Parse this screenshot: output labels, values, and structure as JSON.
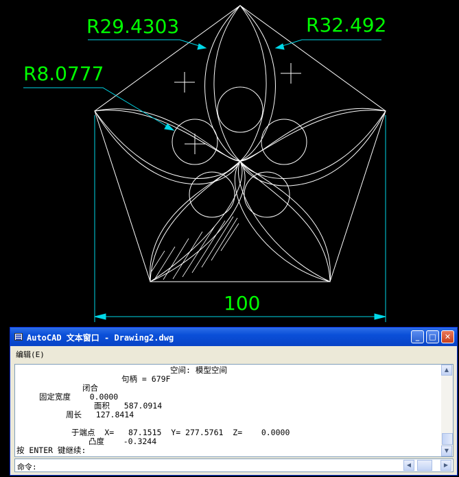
{
  "drawing": {
    "dim_r_top_left": "R29.4303",
    "dim_r_top_right": "R32.492",
    "dim_r_left": "R8.0777",
    "dim_width": "100",
    "colors": {
      "geometry": "#ffffff",
      "dim_text": "#00ff00",
      "dim_line": "#00d8e8",
      "background": "#000000"
    }
  },
  "window": {
    "title": "AutoCAD 文本窗口 - Drawing2.dwg",
    "minimize_icon": "minimize-icon",
    "maximize_icon": "maximize-icon",
    "close_icon": "close-icon",
    "menu": {
      "edit_label": "编辑(E)"
    },
    "lines": [
      "空间: 模型空间",
      "句柄 = 679F",
      "闭合",
      "固定宽度    0.0000",
      "面积   587.0914",
      "周长   127.8414",
      "于端点  X=   87.1515  Y= 277.5761  Z=    0.0000",
      "凸度    -0.3244",
      "按 ENTER 键继续:"
    ],
    "command_prompt": "命令:"
  }
}
